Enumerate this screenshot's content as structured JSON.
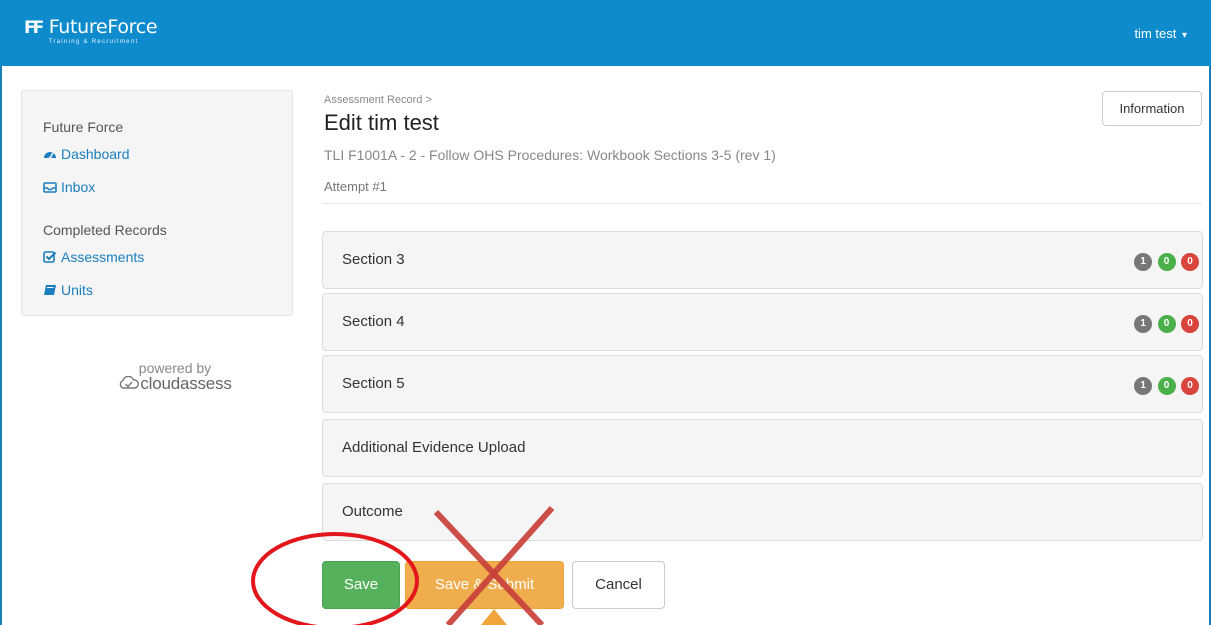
{
  "header": {
    "logo_mark": "FF",
    "logo_name": "FutureForce",
    "logo_tagline": "Training & Recruitment",
    "user_menu": "tim test",
    "caret": "▾",
    "bar_color": "#0d8bcd"
  },
  "sidebar": {
    "heading1": "Future Force",
    "dashboard": "Dashboard",
    "inbox": "Inbox",
    "heading2": "Completed Records",
    "assessments": "Assessments",
    "units": "Units"
  },
  "powered": {
    "text": "powered by",
    "brand": "cloudassess"
  },
  "main": {
    "breadcrumb": "Assessment Record >",
    "title": "Edit tim test",
    "subtitle": "TLI F1001A - 2 - Follow OHS Procedures: Workbook Sections 3-5 (rev 1)",
    "attempt": "Attempt #1",
    "info_button": "Information"
  },
  "sections": [
    {
      "label": "Section 3",
      "badges": [
        "1",
        "0",
        "0"
      ]
    },
    {
      "label": "Section 4",
      "badges": [
        "1",
        "0",
        "0"
      ]
    },
    {
      "label": "Section 5",
      "badges": [
        "1",
        "0",
        "0"
      ]
    },
    {
      "label": "Additional Evidence Upload"
    },
    {
      "label": "Outcome"
    }
  ],
  "actions": {
    "save": "Save",
    "save_submit": "Save & Submit",
    "cancel": "Cancel"
  },
  "colors": {
    "save": "#55b15b",
    "submit": "#f0ad4e",
    "annotation_red": "#e3161c",
    "annotation_cross": "#c8413a"
  }
}
